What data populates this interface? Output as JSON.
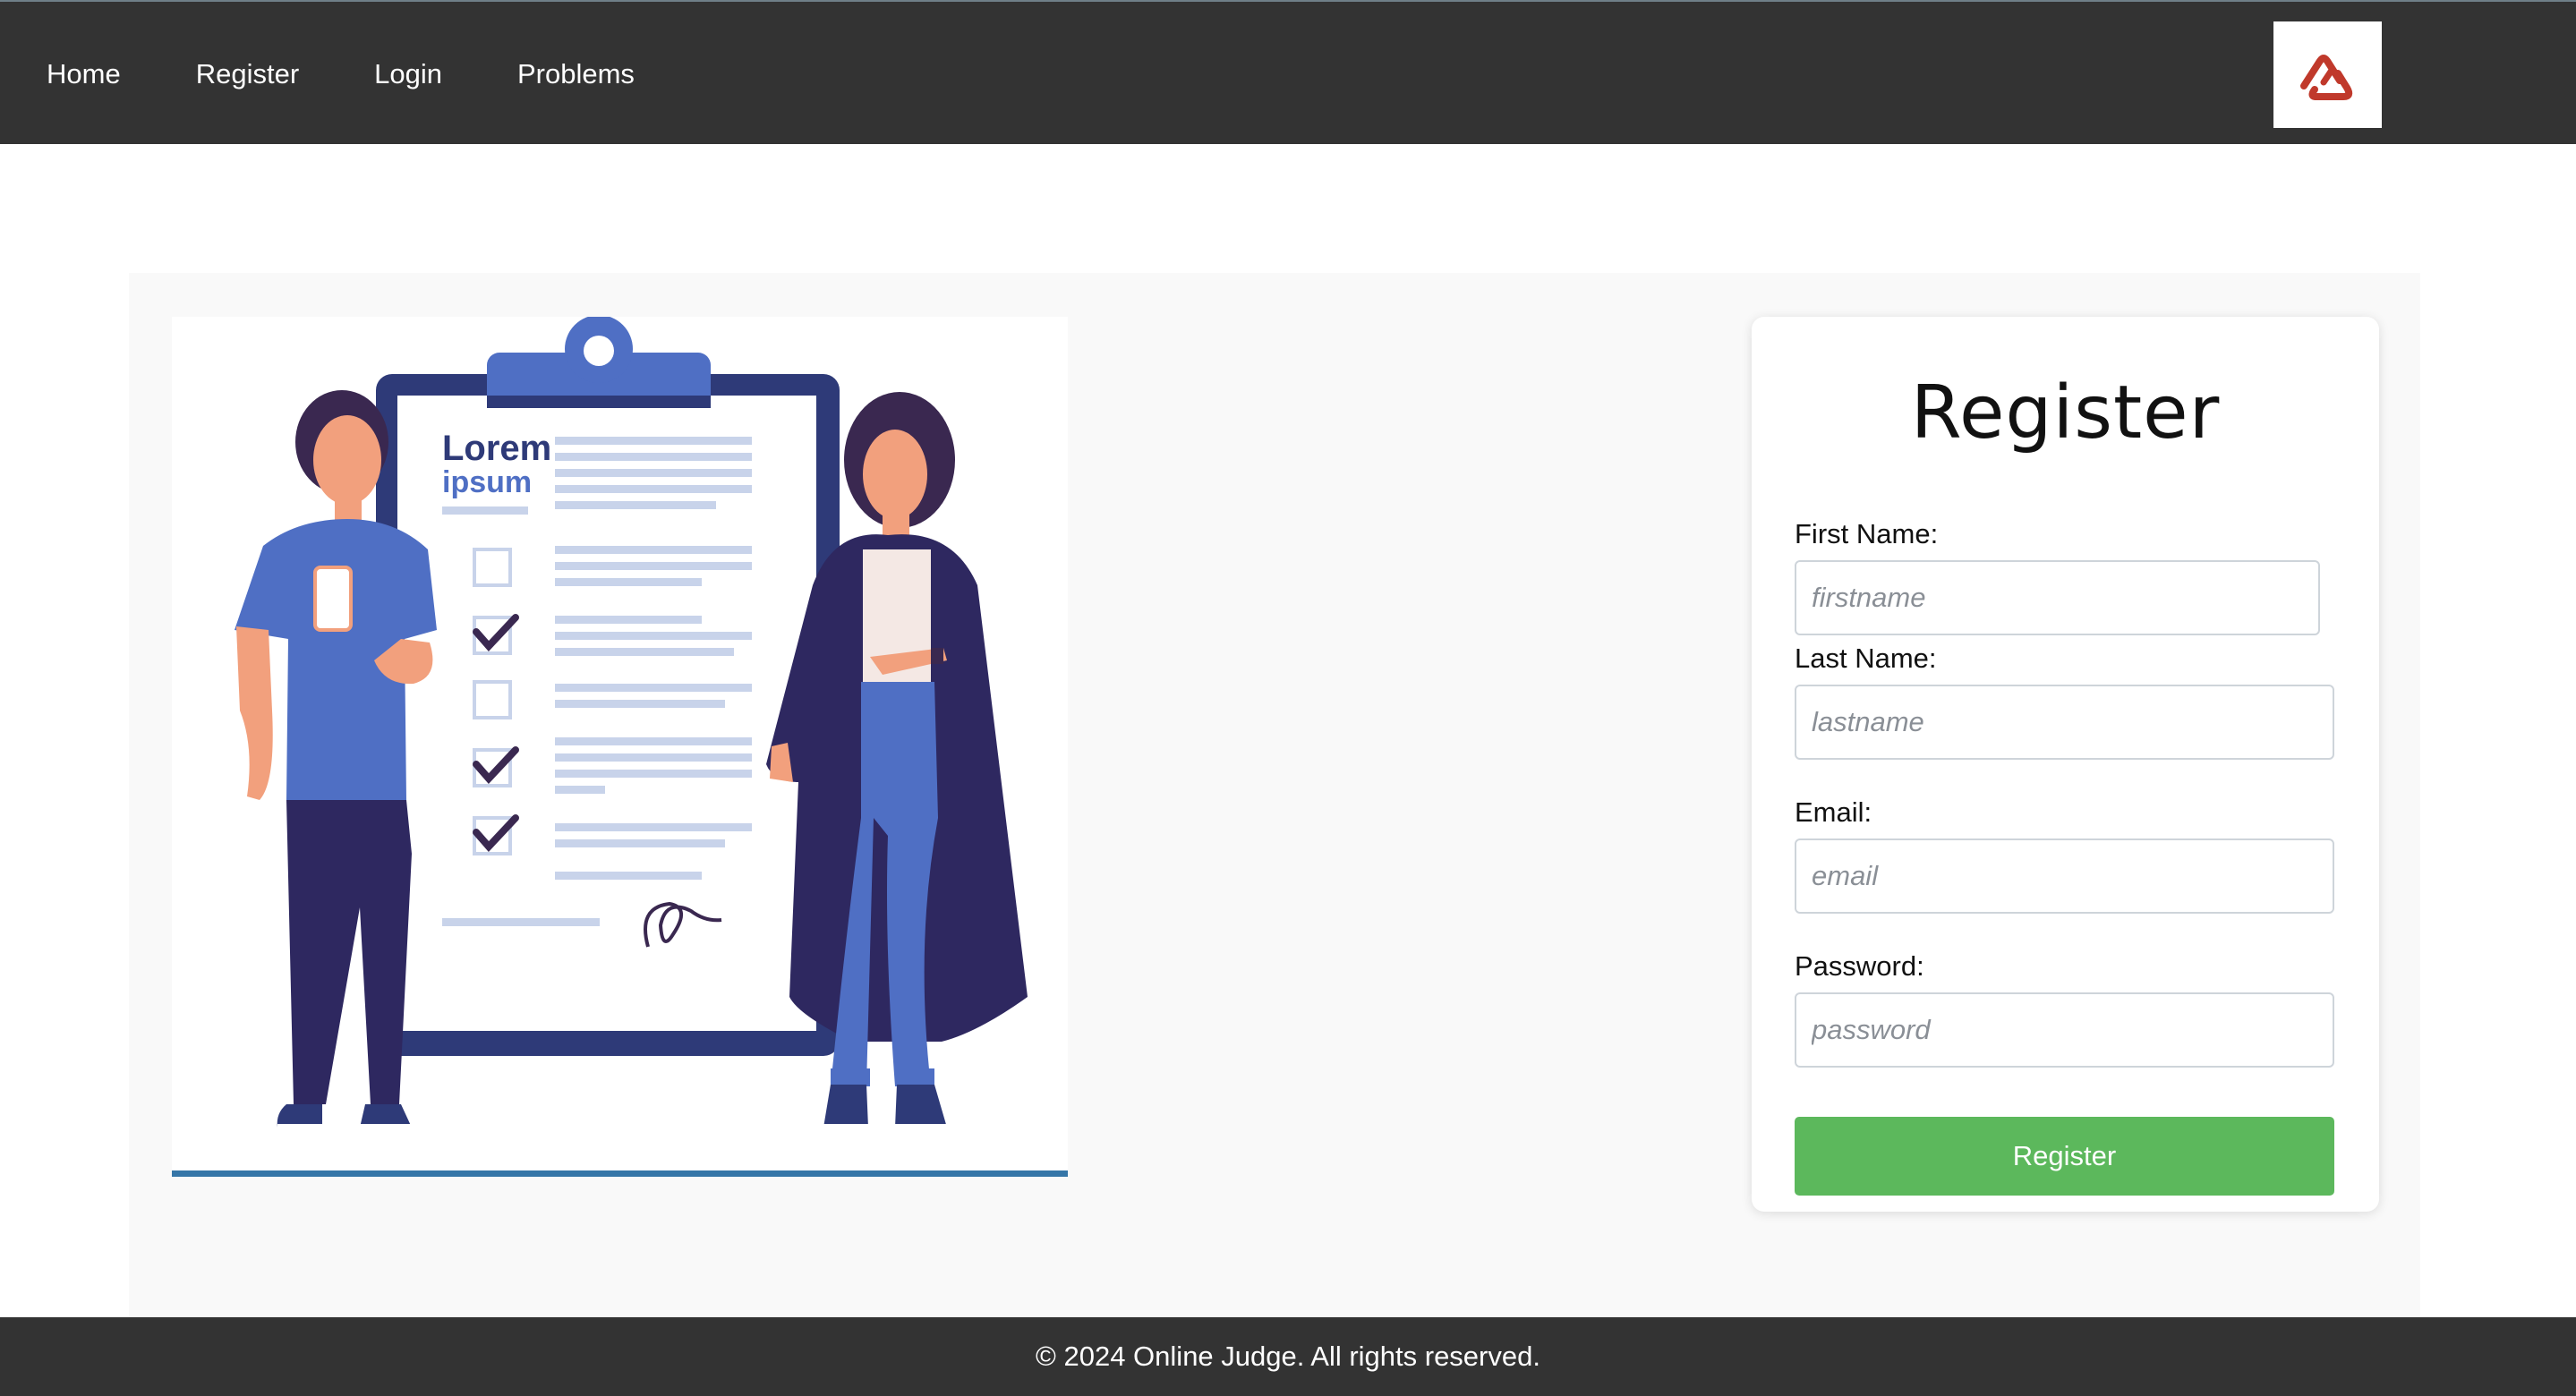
{
  "nav": {
    "links": [
      "Home",
      "Register",
      "Login",
      "Problems"
    ],
    "logo_icon": "brand-logo-icon"
  },
  "illustration": {
    "doc_title": "Lorem",
    "doc_subtitle": "ipsum",
    "icon": "clipboard-checklist-people-illustration"
  },
  "form": {
    "title": "Register",
    "fields": [
      {
        "label": "First Name:",
        "placeholder": "firstname",
        "value": ""
      },
      {
        "label": "Last Name:",
        "placeholder": "lastname",
        "value": ""
      },
      {
        "label": "Email:",
        "placeholder": "email",
        "value": ""
      },
      {
        "label": "Password:",
        "placeholder": "password",
        "value": ""
      }
    ],
    "submit_label": "Register"
  },
  "footer": {
    "text": "© 2024 Online Judge. All rights reserved."
  },
  "colors": {
    "navbar": "#333333",
    "submit": "#5cb85c",
    "logo_red": "#c0392b"
  }
}
